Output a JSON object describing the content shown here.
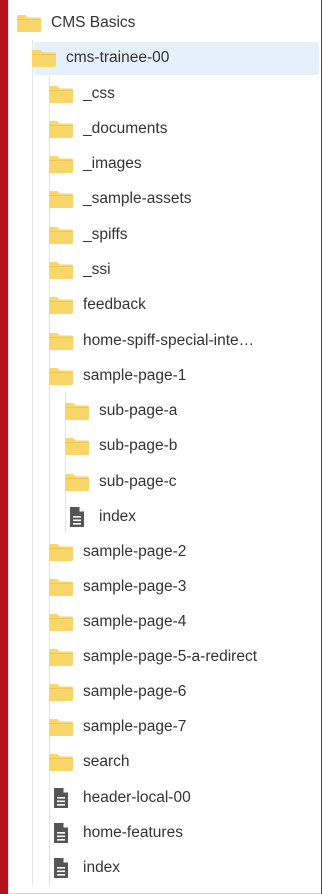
{
  "colors": {
    "folder": "#f9d66a",
    "folder_dark": "#efc652",
    "file": "#555555",
    "selected_bg": "#e6f0fa",
    "frame": "#b5121b"
  },
  "tree": [
    {
      "name": "CMS Basics",
      "icon": "folder-icon",
      "level": 0
    },
    {
      "name": "cms-trainee-00",
      "icon": "folder-icon",
      "level": 1,
      "selected": true
    },
    {
      "name": "_css",
      "icon": "folder-icon",
      "level": 2
    },
    {
      "name": "_documents",
      "icon": "folder-icon",
      "level": 2
    },
    {
      "name": "_images",
      "icon": "folder-icon",
      "level": 2
    },
    {
      "name": "_sample-assets",
      "icon": "folder-icon",
      "level": 2
    },
    {
      "name": "_spiffs",
      "icon": "folder-icon",
      "level": 2
    },
    {
      "name": "_ssi",
      "icon": "folder-icon",
      "level": 2
    },
    {
      "name": "feedback",
      "icon": "folder-icon",
      "level": 2
    },
    {
      "name": "home-spiff-special-inte…",
      "icon": "folder-icon",
      "level": 2
    },
    {
      "name": "sample-page-1",
      "icon": "folder-icon",
      "level": 2
    },
    {
      "name": "sub-page-a",
      "icon": "folder-icon",
      "level": 3
    },
    {
      "name": "sub-page-b",
      "icon": "folder-icon",
      "level": 3
    },
    {
      "name": "sub-page-c",
      "icon": "folder-icon",
      "level": 3
    },
    {
      "name": "index",
      "icon": "file-icon",
      "level": 3
    },
    {
      "name": "sample-page-2",
      "icon": "folder-icon",
      "level": 2
    },
    {
      "name": "sample-page-3",
      "icon": "folder-icon",
      "level": 2
    },
    {
      "name": "sample-page-4",
      "icon": "folder-icon",
      "level": 2
    },
    {
      "name": "sample-page-5-a-redirect",
      "icon": "folder-icon",
      "level": 2
    },
    {
      "name": "sample-page-6",
      "icon": "folder-icon",
      "level": 2
    },
    {
      "name": "sample-page-7",
      "icon": "folder-icon",
      "level": 2
    },
    {
      "name": "search",
      "icon": "folder-icon",
      "level": 2
    },
    {
      "name": "header-local-00",
      "icon": "file-icon",
      "level": 2
    },
    {
      "name": "home-features",
      "icon": "file-icon",
      "level": 2
    },
    {
      "name": "index",
      "icon": "file-icon",
      "level": 2
    }
  ]
}
